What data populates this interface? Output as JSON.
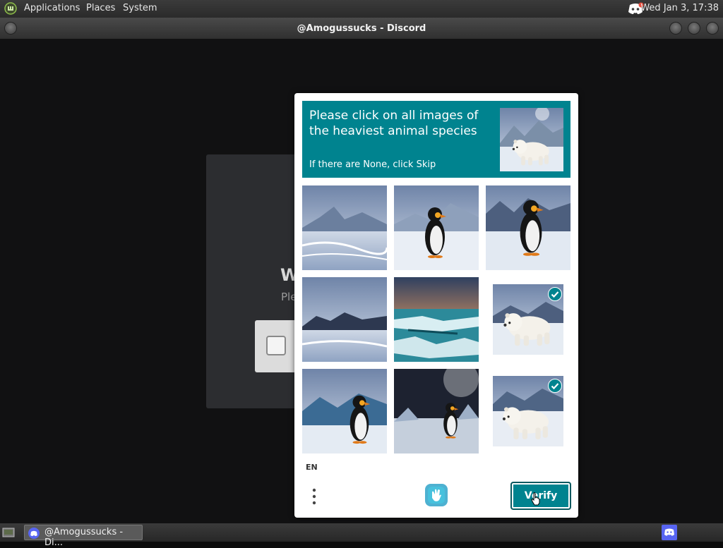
{
  "top_panel": {
    "menus": [
      "Applications",
      "Places",
      "System"
    ],
    "clock": "Wed Jan  3, 17:38"
  },
  "window": {
    "title": "@Amogussucks - Discord"
  },
  "background_app": {
    "heading_fragment": "W",
    "sub_fragment": "Ple"
  },
  "captcha": {
    "prompt": "Please click on all images of the heaviest animal species",
    "skip_hint": "If there are None, click Skip",
    "tiles": [
      {
        "content": "snowy-landscape",
        "selected": false
      },
      {
        "content": "penguin",
        "selected": false
      },
      {
        "content": "penguin",
        "selected": false
      },
      {
        "content": "snowy-mountains",
        "selected": false
      },
      {
        "content": "ice-water",
        "selected": false
      },
      {
        "content": "polar-bear",
        "selected": true
      },
      {
        "content": "penguin",
        "selected": false
      },
      {
        "content": "penguin",
        "selected": false
      },
      {
        "content": "polar-bear",
        "selected": true
      }
    ],
    "language": "EN",
    "verify_label": "Verify",
    "accent": "#00838f"
  },
  "taskbar": {
    "window_label": "@Amogussucks - Di..."
  },
  "icons": [
    "mint-logo-icon",
    "discord-icon",
    "hcaptcha-logo-icon",
    "menu-dots-icon",
    "checkmark-icon",
    "cursor-icon",
    "show-desktop-icon"
  ]
}
